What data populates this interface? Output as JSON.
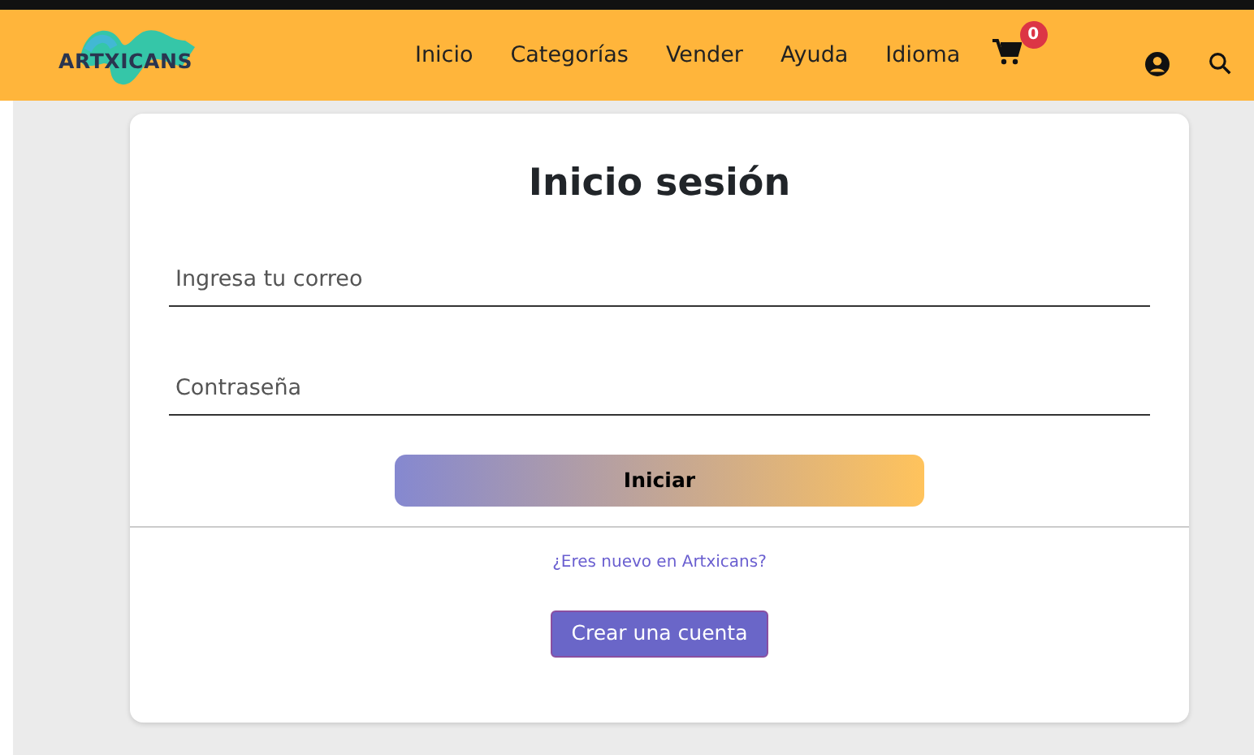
{
  "brand": {
    "name": "ARTXICANS"
  },
  "nav": [
    "Inicio",
    "Categorías",
    "Vender",
    "Ayuda",
    "Idioma"
  ],
  "cart": {
    "count": "0"
  },
  "login": {
    "title": "Inicio sesión",
    "fields": [
      {
        "placeholder": "Ingresa tu correo"
      },
      {
        "placeholder": "Contraseña"
      }
    ],
    "submit": "Iniciar",
    "prompt": "¿Eres nuevo en Artxicans?",
    "signup": "Crear una cuenta"
  }
}
